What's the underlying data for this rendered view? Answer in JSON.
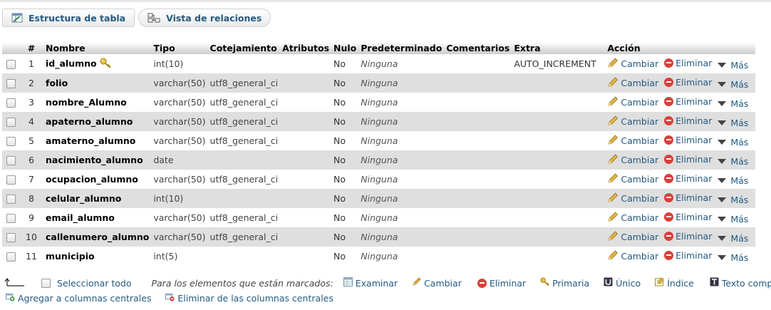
{
  "tabs": [
    {
      "label": "Estructura de tabla",
      "icon": "table-structure-icon"
    },
    {
      "label": "Vista de relaciones",
      "icon": "relations-icon"
    }
  ],
  "columns": {
    "num": "#",
    "name": "Nombre",
    "type": "Tipo",
    "collation": "Cotejamiento",
    "attributes": "Atributos",
    "null": "Nulo",
    "default": "Predeterminado",
    "comments": "Comentarios",
    "extra": "Extra",
    "action": "Acción"
  },
  "actions": {
    "change": "Cambiar",
    "drop": "Eliminar",
    "more": "Más"
  },
  "rows": [
    {
      "num": "1",
      "name": "id_alumno",
      "type": "int(10)",
      "collation": "",
      "null": "No",
      "default": "Ninguna",
      "extra": "AUTO_INCREMENT",
      "primary_key": true
    },
    {
      "num": "2",
      "name": "folio",
      "type": "varchar(50)",
      "collation": "utf8_general_ci",
      "null": "No",
      "default": "Ninguna",
      "extra": ""
    },
    {
      "num": "3",
      "name": "nombre_Alumno",
      "type": "varchar(50)",
      "collation": "utf8_general_ci",
      "null": "No",
      "default": "Ninguna",
      "extra": ""
    },
    {
      "num": "4",
      "name": "apaterno_alumno",
      "type": "varchar(50)",
      "collation": "utf8_general_ci",
      "null": "No",
      "default": "Ninguna",
      "extra": ""
    },
    {
      "num": "5",
      "name": "amaterno_alumno",
      "type": "varchar(50)",
      "collation": "utf8_general_ci",
      "null": "No",
      "default": "Ninguna",
      "extra": ""
    },
    {
      "num": "6",
      "name": "nacimiento_alumno",
      "type": "date",
      "collation": "",
      "null": "No",
      "default": "Ninguna",
      "extra": ""
    },
    {
      "num": "7",
      "name": "ocupacion_alumno",
      "type": "varchar(50)",
      "collation": "utf8_general_ci",
      "null": "No",
      "default": "Ninguna",
      "extra": ""
    },
    {
      "num": "8",
      "name": "celular_alumno",
      "type": "int(10)",
      "collation": "",
      "null": "No",
      "default": "Ninguna",
      "extra": ""
    },
    {
      "num": "9",
      "name": "email_alumno",
      "type": "varchar(50)",
      "collation": "utf8_general_ci",
      "null": "No",
      "default": "Ninguna",
      "extra": ""
    },
    {
      "num": "10",
      "name": "callenumero_alumno",
      "type": "varchar(50)",
      "collation": "utf8_general_ci",
      "null": "No",
      "default": "Ninguna",
      "extra": ""
    },
    {
      "num": "11",
      "name": "municipio",
      "type": "int(5)",
      "collation": "",
      "null": "No",
      "default": "Ninguna",
      "extra": ""
    }
  ],
  "bulk": {
    "select_all": "Seleccionar todo",
    "marked_label": "Para los elementos que están marcados:",
    "browse": "Examinar",
    "change": "Cambiar",
    "drop": "Eliminar",
    "primary": "Primaria",
    "unique": "Único",
    "index": "Índice",
    "fulltext": "Texto completo"
  },
  "central": {
    "add": "Agregar a columnas centrales",
    "remove": "Eliminar de las columnas centrales"
  },
  "colors": {
    "link": "#235a81",
    "row_alt": "#dfdfdf",
    "danger": "#d9403a",
    "pencil": "#e5b43c"
  }
}
